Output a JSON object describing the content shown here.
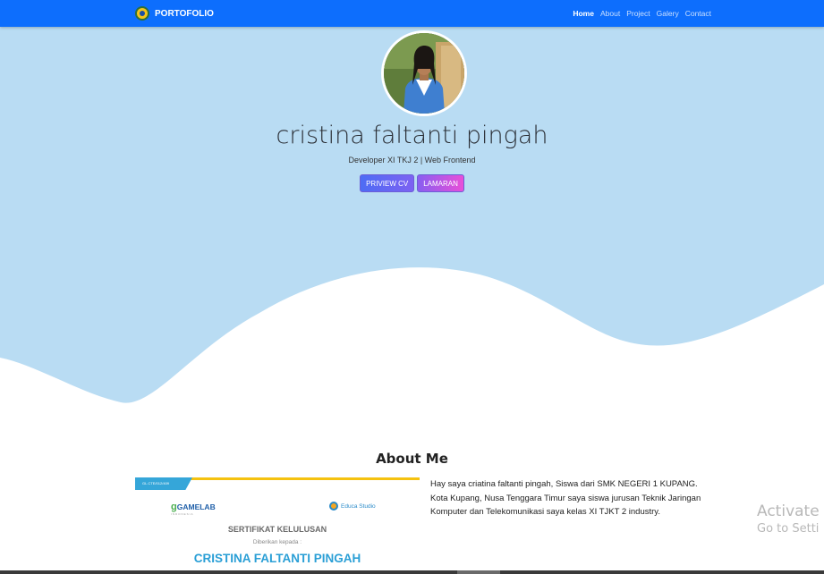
{
  "navbar": {
    "brand": "PORTOFOLIO",
    "links": [
      "Home",
      "About",
      "Project",
      "Galery",
      "Contact"
    ]
  },
  "hero": {
    "name": "cristina faltanti pingah",
    "subtitle": "Developer XI TKJ 2 | Web Frontend",
    "buttons": [
      "PRIVIEW CV",
      "LAMARAN"
    ]
  },
  "about": {
    "title": "About Me",
    "text": "Hay saya criatina faltanti pingah, Siswa dari SMK NEGERI 1 KUPANG. Kota Kupang, Nusa Tenggara Timur saya siswa jurusan Teknik Jaringan Komputer dan Telekomunikasi saya kelas XI TJKT 2 industry.",
    "certificate": {
      "tag": "GL.CTE/012/409",
      "logo_left": "GAMELAB",
      "logo_left_sub": "INDONESIA",
      "logo_right": "Educa Studio",
      "heading": "SERTIFIKAT KELULUSAN",
      "given_to": "Diberikan kepada :",
      "recipient": "CRISTINA FALTANTI PINGAH"
    }
  },
  "watermark": {
    "line1": "Activate",
    "line2": "Go to Setti"
  },
  "colors": {
    "navbar": "#0d6efd",
    "hero": "#b9dcf3",
    "button_gradient_1": "#4d6cf4",
    "button_gradient_2": "#e84fd8",
    "cert_accent": "#2a9fd6"
  }
}
